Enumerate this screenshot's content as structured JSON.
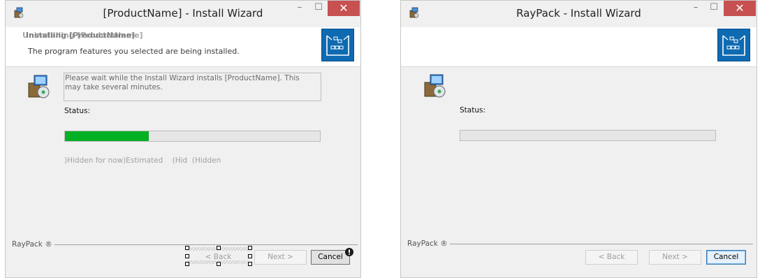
{
  "left_window": {
    "title": "[ProductName] - Install Wizard",
    "minimize_label": "–",
    "maximize_label": "☐",
    "close_label": "✕",
    "header_title": "Installing [ProductName]",
    "header_title_ghost": "Uninstalling [ProductName]",
    "header_description": "The program features you selected are being installed.",
    "wait_text": "Please wait while the Install Wizard installs [ProductName]. This may take several minutes.",
    "status_label": "Status:",
    "progress_percent": 33,
    "hidden_text": ")Hidden for now)Estimated    (Hid  (Hidden",
    "brand": "RayPack ®",
    "back_label": "< Back",
    "next_label": "Next >",
    "cancel_label": "Cancel"
  },
  "right_window": {
    "title": "RayPack - Install Wizard",
    "minimize_label": "–",
    "maximize_label": "☐",
    "close_label": "✕",
    "status_label": "Status:",
    "progress_percent": 0,
    "brand": "RayPack ®",
    "back_label": "< Back",
    "next_label": "Next >",
    "cancel_label": "Cancel"
  },
  "colors": {
    "progress_fill": "#06b025",
    "close_button": "#c75050",
    "logo_blue": "#0e6ab1"
  }
}
